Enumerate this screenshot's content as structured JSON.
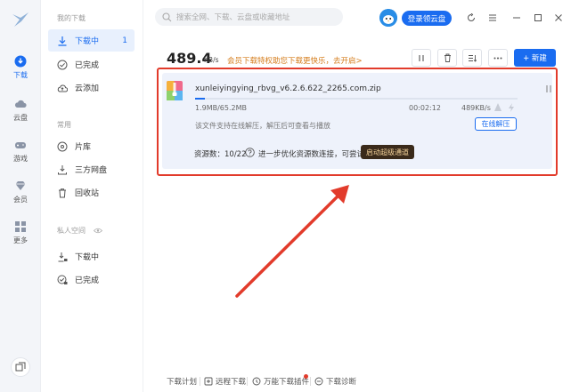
{
  "rail": {
    "items": [
      {
        "label": "下载",
        "icon": "download-icon"
      },
      {
        "label": "云盘",
        "icon": "cloud-icon"
      },
      {
        "label": "游戏",
        "icon": "gamepad-icon"
      },
      {
        "label": "会员",
        "icon": "diamond-icon"
      },
      {
        "label": "更多",
        "icon": "grid-icon"
      }
    ]
  },
  "sidebar": {
    "section_downloads": "我的下载",
    "downloads": [
      {
        "label": "下载中",
        "count": "1"
      },
      {
        "label": "已完成"
      },
      {
        "label": "云添加"
      }
    ],
    "section_common": "常用",
    "common": [
      {
        "label": "片库"
      },
      {
        "label": "三方网盘"
      },
      {
        "label": "回收站"
      }
    ],
    "section_private": "私人空间",
    "private": [
      {
        "label": "下载中"
      },
      {
        "label": "已完成"
      }
    ]
  },
  "topbar": {
    "search_placeholder": "搜索全网、下载、云盘或收藏地址",
    "login_label": "登录领云盘"
  },
  "speedbar": {
    "speed": "489.4",
    "unit": "KB/s",
    "vip_note": "会员下载特权助您下载更快乐，去开启>",
    "new_label": "+ 新建"
  },
  "task": {
    "file_name": "xunleiyingying_rbvg_v6.2.6.622_2265.com.zip",
    "progress": 0.03,
    "size": "1.9MB/65.2MB",
    "time": "00:02:12",
    "rate": "489KB/s",
    "hint": "该文件支持在线解压，解压后可查看与播放",
    "online_unzip_label": "在线解压",
    "sources": "资源数：10/22",
    "optimize_note": "进一步优化资源数连接，可尝试",
    "boost_label": "启动超级通道"
  },
  "footer": {
    "items": [
      "下载计划",
      "远程下载",
      "万能下载插件",
      "下载诊断"
    ]
  },
  "colors": {
    "accent": "#1a6cf0",
    "highlight": "#e23b2b",
    "vip": "#d57d1c",
    "card_bg": "#eef2fb"
  }
}
